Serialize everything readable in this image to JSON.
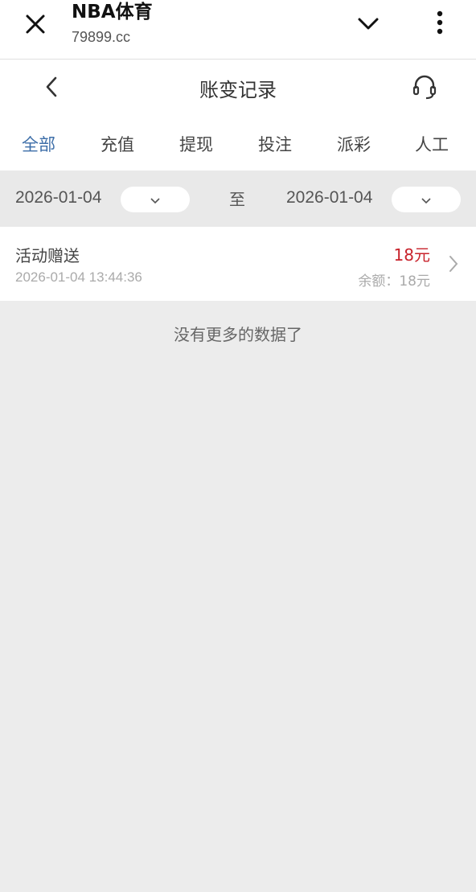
{
  "browser": {
    "title": "NBA体育",
    "url": "79899.cc",
    "close_icon": "close-icon",
    "chevron_icon": "chevron-down-icon",
    "more_icon": "more-vertical-icon"
  },
  "header": {
    "title": "账变记录",
    "back_icon": "back-arrow-icon",
    "support_icon": "headset-icon"
  },
  "tabs": [
    {
      "label": "全部",
      "active": true
    },
    {
      "label": "充值",
      "active": false
    },
    {
      "label": "提现",
      "active": false
    },
    {
      "label": "投注",
      "active": false
    },
    {
      "label": "派彩",
      "active": false
    },
    {
      "label": "人工",
      "active": false
    }
  ],
  "filter": {
    "start_date": "2026-01-04",
    "end_date": "2026-01-04",
    "separator": "至"
  },
  "records": [
    {
      "title": "活动赠送",
      "time": "2026-01-04 13:44:36",
      "amount": "18元",
      "balance": "余额：18元"
    }
  ],
  "empty_message": "没有更多的数据了",
  "colors": {
    "accent": "#3d6ea8",
    "amount": "#c8232c",
    "background": "#ececec"
  }
}
